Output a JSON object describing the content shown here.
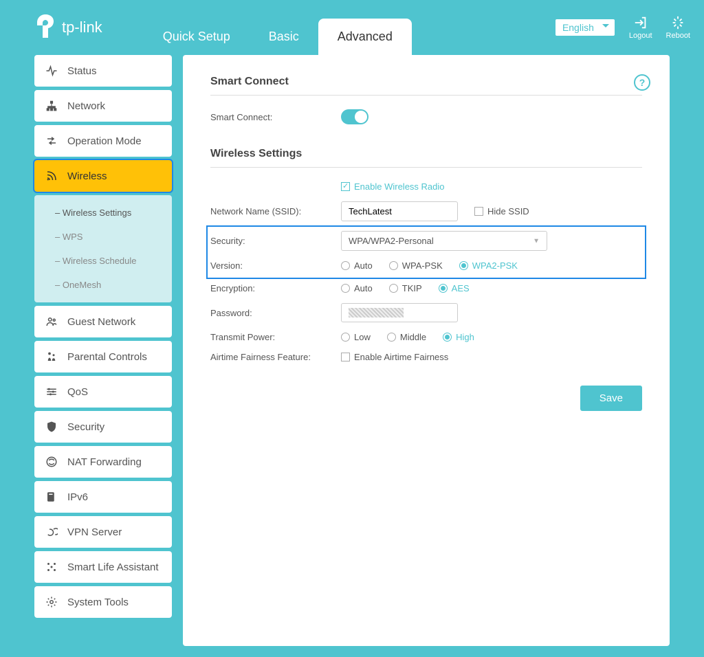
{
  "brand": "tp-link",
  "tabs": {
    "quick": "Quick Setup",
    "basic": "Basic",
    "advanced": "Advanced"
  },
  "header": {
    "language": "English",
    "logout": "Logout",
    "reboot": "Reboot"
  },
  "sidebar": {
    "status": "Status",
    "network": "Network",
    "operation": "Operation Mode",
    "wireless": "Wireless",
    "sub": {
      "ws": "Wireless Settings",
      "wps": "WPS",
      "sch": "Wireless Schedule",
      "om": "OneMesh"
    },
    "guest": "Guest Network",
    "parental": "Parental Controls",
    "qos": "QoS",
    "security": "Security",
    "nat": "NAT Forwarding",
    "ipv6": "IPv6",
    "vpn": "VPN Server",
    "smart": "Smart Life Assistant",
    "tools": "System Tools"
  },
  "content": {
    "smart_connect_title": "Smart Connect",
    "smart_connect_label": "Smart Connect:",
    "wireless_title": "Wireless Settings",
    "enable_radio": "Enable Wireless Radio",
    "ssid_label": "Network Name (SSID):",
    "ssid_value": "TechLatest",
    "hide_ssid": "Hide SSID",
    "security_label": "Security:",
    "security_value": "WPA/WPA2-Personal",
    "version_label": "Version:",
    "version_opts": {
      "auto": "Auto",
      "wpa": "WPA-PSK",
      "wpa2": "WPA2-PSK"
    },
    "encryption_label": "Encryption:",
    "encryption_opts": {
      "auto": "Auto",
      "tkip": "TKIP",
      "aes": "AES"
    },
    "password_label": "Password:",
    "transmit_label": "Transmit Power:",
    "transmit_opts": {
      "low": "Low",
      "mid": "Middle",
      "high": "High"
    },
    "airtime_label": "Airtime Fairness Feature:",
    "airtime_cb": "Enable Airtime Fairness",
    "save": "Save"
  }
}
